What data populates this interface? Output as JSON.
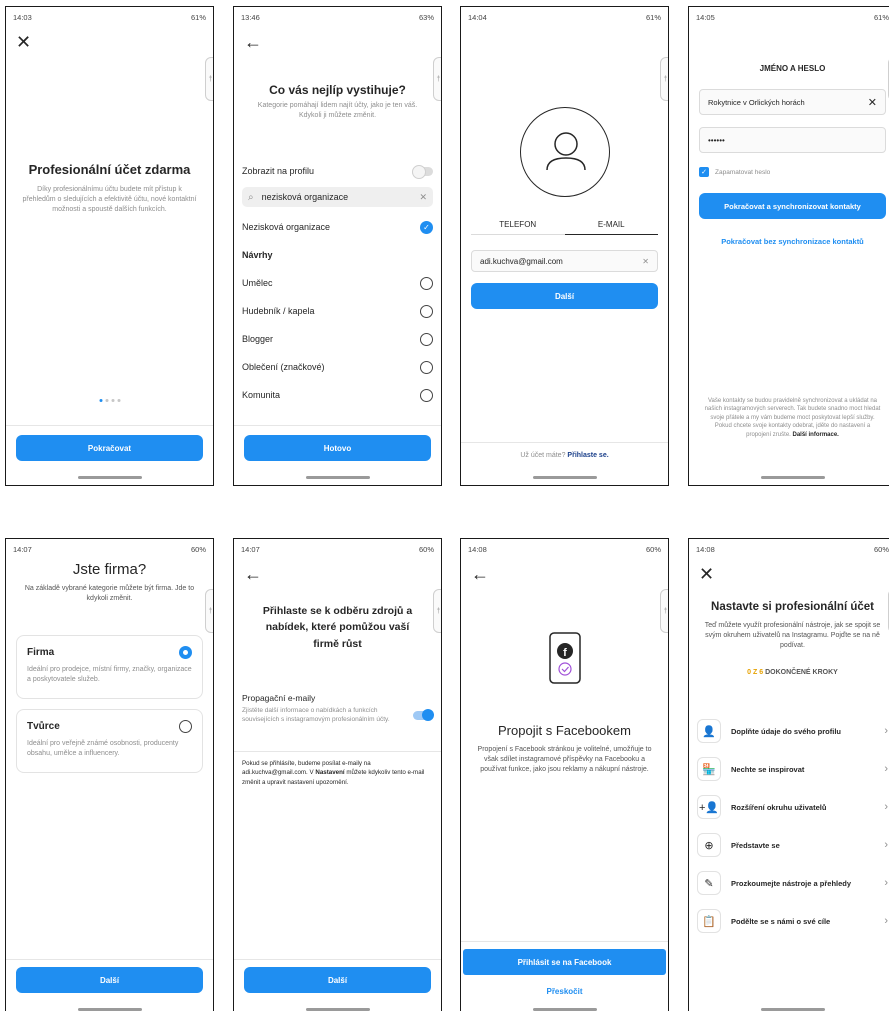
{
  "s1": {
    "status_time": "14:03",
    "status_right": "61%",
    "title": "Profesionální účet zdarma",
    "description": "Díky profesionálnímu účtu budete mít přístup k přehledům o sledujících a efektivitě účtu, nové kontaktní možnosti a spoustě dalších funkcích.",
    "button": "Pokračovat"
  },
  "s2": {
    "status_time": "13:46",
    "status_right": "63%",
    "title": "Co vás nejlíp vystihuje?",
    "description": "Kategorie pomáhají lidem najít účty, jako je ten váš. Kdykoli ji můžete změnit.",
    "show_profile": "Zobrazit na profilu",
    "search_value": "nezisková organizace",
    "selected": "Nezisková organizace",
    "suggestions_header": "Návrhy",
    "suggestions": [
      "Umělec",
      "Hudebník / kapela",
      "Blogger",
      "Oblečení (značkové)",
      "Komunita"
    ],
    "button": "Hotovo"
  },
  "s3": {
    "status_time": "14:04",
    "status_right": "61%",
    "tab_phone": "TELEFON",
    "tab_email": "E-MAIL",
    "email_value": "adi.kuchva@gmail.com",
    "button": "Další",
    "footer_text": "Už účet máte?",
    "footer_link": "Přihlaste se."
  },
  "s4": {
    "status_time": "14:05",
    "status_right": "61%",
    "title": "JMÉNO A HESLO",
    "name_value": "Rokytnice v Orlických horách",
    "password_value": "••••••",
    "remember": "Zapamatovat heslo",
    "button": "Pokračovat a synchronizovat kontakty",
    "link": "Pokračovat bez synchronizace kontaktů",
    "footer": "Vaše kontakty se budou pravidelně synchronizovat a ukládat na našich instagramových serverech. Tak budete snadno moct hledat svoje přátele a my vám budeme moct poskytovat lepší služby. Pokud chcete svoje kontakty odebrat, jděte do nastavení a propojení zrušte.",
    "footer_link": "Další informace."
  },
  "s5": {
    "status_time": "14:07",
    "status_right": "60%",
    "title": "Jste firma?",
    "description": "Na základě vybrané kategorie můžete být firma. Jde to kdykoli změnit.",
    "firma_title": "Firma",
    "firma_desc": "Ideální pro prodejce, místní firmy, značky, organizace a poskytovatele služeb.",
    "tvurce_title": "Tvůrce",
    "tvurce_desc": "Ideální pro veřejně známé osobnosti, producenty obsahu, umělce a influencery.",
    "button": "Další"
  },
  "s6": {
    "status_time": "14:07",
    "status_right": "60%",
    "title": "Přihlaste se k odběru zdrojů a nabídek, které pomůžou vaší firmě růst",
    "promo_title": "Propagační e-maily",
    "promo_desc": "Zjistěte další informace o nabídkách a funkcích souvisejících s instagramovým profesionálním účty.",
    "note_1": "Pokud se přihlásíte, budeme posílat e-maily na adi.kuchva@gmail.com. V",
    "note_bold": "Nastavení",
    "note_2": "můžete kdykoliv tento e-mail změnit a upravit nastavení upozornění.",
    "button": "Další"
  },
  "s7": {
    "status_time": "14:08",
    "status_right": "60%",
    "title": "Propojit s Facebookem",
    "description": "Propojení s Facebook stránkou je volitelné, umožňuje to však sdílet instagramové příspěvky na Facebooku a používat funkce, jako jsou reklamy a nákupní nástroje.",
    "button": "Přihlásit se na Facebook",
    "skip": "Přeskočit"
  },
  "s8": {
    "status_time": "14:08",
    "status_right": "60%",
    "title": "Nastavte si profesionální účet",
    "description": "Teď můžete využít profesionální nástroje, jak se spojit se svým okruhem uživatelů na Instagramu. Pojďte se na ně podívat.",
    "progress": "0 Z 6",
    "progress_label": "DOKONČENÉ KROKY",
    "steps": [
      {
        "icon": "👤",
        "label": "Doplňte údaje do svého profilu"
      },
      {
        "icon": "🏪",
        "label": "Nechte se inspirovat"
      },
      {
        "icon": "+👤",
        "label": "Rozšíření okruhu uživatelů"
      },
      {
        "icon": "⊕",
        "label": "Představte se"
      },
      {
        "icon": "✎",
        "label": "Prozkoumejte nástroje a přehledy"
      },
      {
        "icon": "📋",
        "label": "Podělte se s námi o své cíle"
      }
    ]
  },
  "colors": {
    "accent": "#1f8ef1",
    "text": "#262626",
    "muted": "#8e8e8e",
    "progress": "#e6a100"
  }
}
